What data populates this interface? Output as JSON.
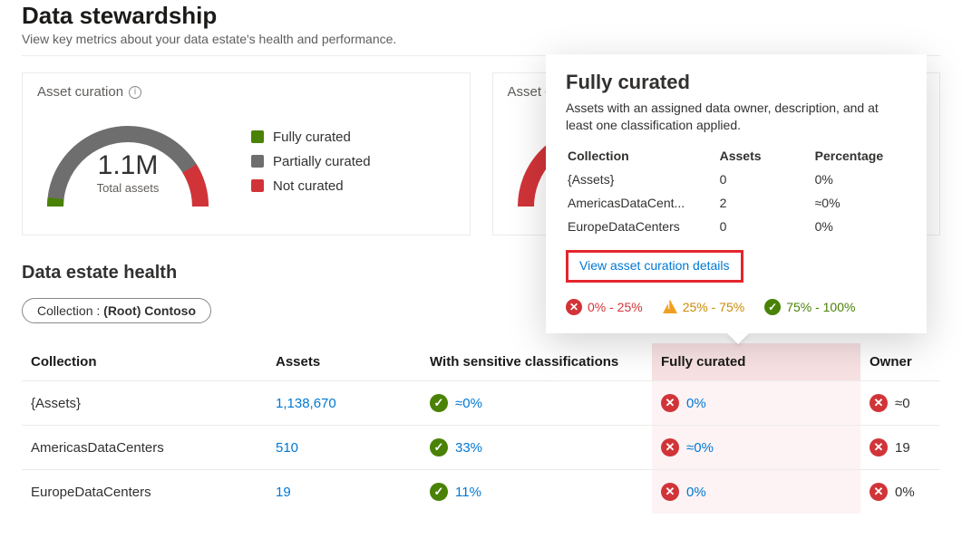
{
  "page": {
    "title": "Data stewardship",
    "subtitle": "View key metrics about your data estate's health and performance."
  },
  "cards": {
    "curation": {
      "title": "Asset curation",
      "total_value": "1.1M",
      "total_label": "Total assets",
      "legend": [
        {
          "label": "Fully curated",
          "color": "#498205"
        },
        {
          "label": "Partially curated",
          "color": "#6e6e6e"
        },
        {
          "label": "Not curated",
          "color": "#d13438"
        }
      ]
    },
    "card2": {
      "title_prefix": "Asset c"
    }
  },
  "tooltip": {
    "title": "Fully curated",
    "description": "Assets with an assigned data owner, description, and at least one classification applied.",
    "headers": {
      "collection": "Collection",
      "assets": "Assets",
      "percentage": "Percentage"
    },
    "rows": [
      {
        "collection": "{Assets}",
        "assets": "0",
        "percentage": "0%"
      },
      {
        "collection": "AmericasDataCent...",
        "assets": "2",
        "percentage": "≈0%"
      },
      {
        "collection": "EuropeDataCenters",
        "assets": "0",
        "percentage": "0%"
      }
    ],
    "link_label": "View asset curation details",
    "legend": [
      {
        "text": "0% - 25%",
        "color": "#d13438",
        "icon": "x"
      },
      {
        "text": "25% - 75%",
        "color": "#f0a020",
        "icon": "warn"
      },
      {
        "text": "75% - 100%",
        "color": "#498205",
        "icon": "check"
      }
    ]
  },
  "section": {
    "title": "Data estate health",
    "filter_label": "Collection : ",
    "filter_value": "(Root) Contoso"
  },
  "table": {
    "headers": {
      "collection": "Collection",
      "assets": "Assets",
      "sensitive": "With sensitive classifications",
      "curated": "Fully curated",
      "owner": "Owner"
    },
    "rows": [
      {
        "collection": "{Assets}",
        "assets": "1,138,670",
        "sensitive": {
          "pct": "≈0%",
          "status": "ok"
        },
        "curated": {
          "pct": "0%",
          "status": "bad"
        },
        "owner": {
          "pct": "≈0",
          "status": "bad"
        }
      },
      {
        "collection": "AmericasDataCenters",
        "assets": "510",
        "sensitive": {
          "pct": "33%",
          "status": "ok"
        },
        "curated": {
          "pct": "≈0%",
          "status": "bad"
        },
        "owner": {
          "pct": "19",
          "status": "bad"
        }
      },
      {
        "collection": "EuropeDataCenters",
        "assets": "19",
        "sensitive": {
          "pct": "11%",
          "status": "ok"
        },
        "curated": {
          "pct": "0%",
          "status": "bad"
        },
        "owner": {
          "pct": "0%",
          "status": "bad"
        }
      }
    ]
  },
  "chart_data": {
    "type": "pie",
    "title": "Asset curation",
    "total": "1.1M",
    "series": [
      {
        "name": "Fully curated",
        "value_pct": 1,
        "color": "#498205"
      },
      {
        "name": "Partially curated",
        "value_pct": 93,
        "color": "#6e6e6e"
      },
      {
        "name": "Not curated",
        "value_pct": 6,
        "color": "#d13438"
      }
    ]
  }
}
